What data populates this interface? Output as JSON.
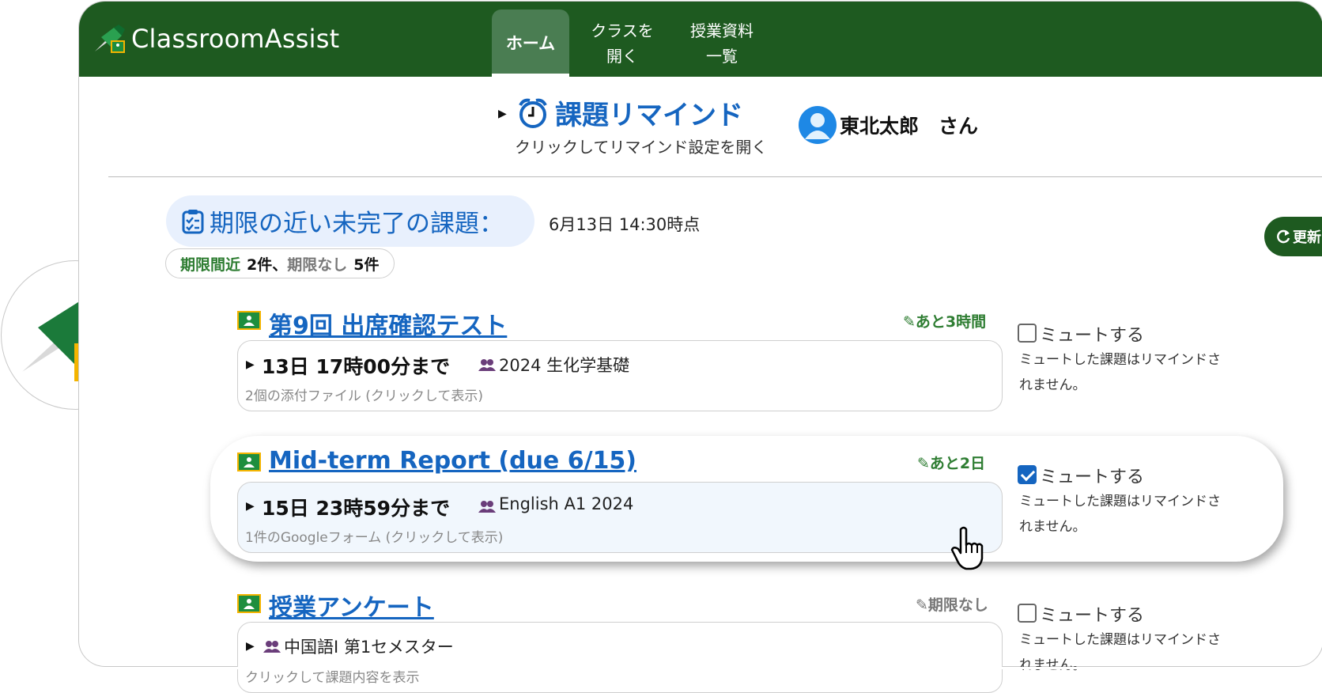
{
  "header": {
    "app_title": "ClassroomAssist",
    "tabs": [
      {
        "label": "ホーム",
        "active": true
      },
      {
        "label": "クラスを\n開く",
        "active": false
      },
      {
        "label": "授業資料\n一覧",
        "active": false
      }
    ]
  },
  "remind": {
    "title": "課題リマインド",
    "subtitle": "クリックしてリマインド設定を開く"
  },
  "user": {
    "name": "東北太郎　さん"
  },
  "section": {
    "title": "期限の近い未完了の課題：",
    "timestamp": "6月13日 14:30時点",
    "counts": {
      "near_label": "期限間近",
      "near_count": "2件、",
      "none_label": "期限なし",
      "none_count": "5件"
    },
    "refresh_label": "更新"
  },
  "assignments": [
    {
      "title": "第9回 出席確認テスト",
      "due_badge": "あと3時間",
      "deadline": "13日 17時00分まで",
      "class_name": "2024 生化学基礎",
      "attachment": "2個の添付ファイル (クリックして表示)",
      "mute_label": "ミュートする",
      "muted": false,
      "mute_note": "ミュートした課題はリマインドされません。"
    },
    {
      "title": "Mid-term Report (due 6/15)",
      "due_badge": "あと2日",
      "deadline": "15日 23時59分まで",
      "class_name": "English A1 2024",
      "attachment": "1件のGoogleフォーム (クリックして表示)",
      "mute_label": "ミュートする",
      "muted": true,
      "mute_note": "ミュートした課題はリマインドされません。"
    },
    {
      "title": "授業アンケート",
      "due_badge": "期限なし",
      "deadline": "",
      "class_name": "中国語Ⅰ 第1セメスター",
      "attachment": "クリックして課題内容を表示",
      "mute_label": "ミュートする",
      "muted": false,
      "mute_note": "ミュートした課題はリマインドされません。"
    }
  ],
  "colors": {
    "header_bg": "#1e5a20",
    "accent_blue": "#1565c0",
    "due_green": "#2e7d32"
  }
}
